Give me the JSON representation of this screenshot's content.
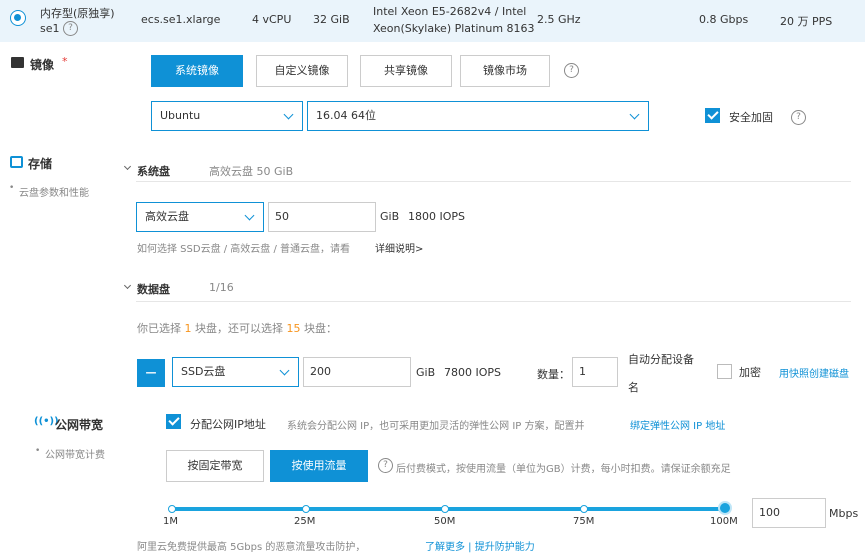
{
  "instance_row": {
    "family": "内存型(原独享)",
    "family2": "se1",
    "type": "ecs.se1.xlarge",
    "vcpu": "4 vCPU",
    "memory": "32 GiB",
    "cpu_line1": "Intel Xeon E5-2682v4 / Intel",
    "cpu_line2": "Xeon(Skylake) Platinum 8163",
    "freq": "2.5 GHz",
    "bandwidth": "0.8 Gbps",
    "pps": "20 万 PPS"
  },
  "image": {
    "label": "镜像",
    "required": "*",
    "tabs": [
      "系统镜像",
      "自定义镜像",
      "共享镜像",
      "镜像市场"
    ],
    "os": "Ubuntu",
    "version": "16.04 64位",
    "security": "安全加固"
  },
  "storage": {
    "label": "存储",
    "sub": "云盘参数和性能",
    "system_disk": {
      "title": "系统盘",
      "summary": "高效云盘  50 GiB",
      "type": "高效云盘",
      "size": "50",
      "unit": "GiB",
      "iops": "1800 IOPS",
      "hint": "如何选择 SSD云盘 / 高效云盘 / 普通云盘，请看",
      "hint_link": "详细说明>"
    },
    "data_disk": {
      "title": "数据盘",
      "count": "1/16",
      "selected_prefix": "你已选择",
      "selected_n": "1",
      "selected_mid": "块盘，还可以选择",
      "remaining_n": "15",
      "selected_suffix": "块盘：",
      "remove": "—",
      "type": "SSD云盘",
      "size": "200",
      "unit": "GiB",
      "iops": "7800 IOPS",
      "qty_label": "数量：",
      "qty": "1",
      "auto_assign_1": "自动分配设备",
      "auto_assign_2": "名",
      "encrypt": "加密",
      "snapshot_link": "用快照创建磁盘"
    }
  },
  "network": {
    "label": "公网带宽",
    "sub": "公网带宽计费",
    "assign_ip": "分配公网IP地址",
    "assign_note": "系统会分配公网 IP，也可采用更加灵活的弹性公网 IP 方案，配置并",
    "assign_link": "绑定弹性公网 IP 地址",
    "billing_tabs": [
      "按固定带宽",
      "按使用流量"
    ],
    "billing_note": "后付费模式，按使用流量（单位为GB）计费，每小时扣费。请保证余额充足",
    "slider_ticks": [
      "1M",
      "25M",
      "50M",
      "75M",
      "100M"
    ],
    "slider_value": 100,
    "slider_max": 100,
    "bw_input": "100",
    "bw_unit": "Mbps",
    "ddos_note": "阿里云免费提供最高 5Gbps 的恶意流量攻击防护，",
    "ddos_link": "了解更多 | 提升防护能力"
  },
  "colors": {
    "accent": "#0f91d6",
    "orange": "#f7941d",
    "row_bg": "#eaf4fb"
  }
}
